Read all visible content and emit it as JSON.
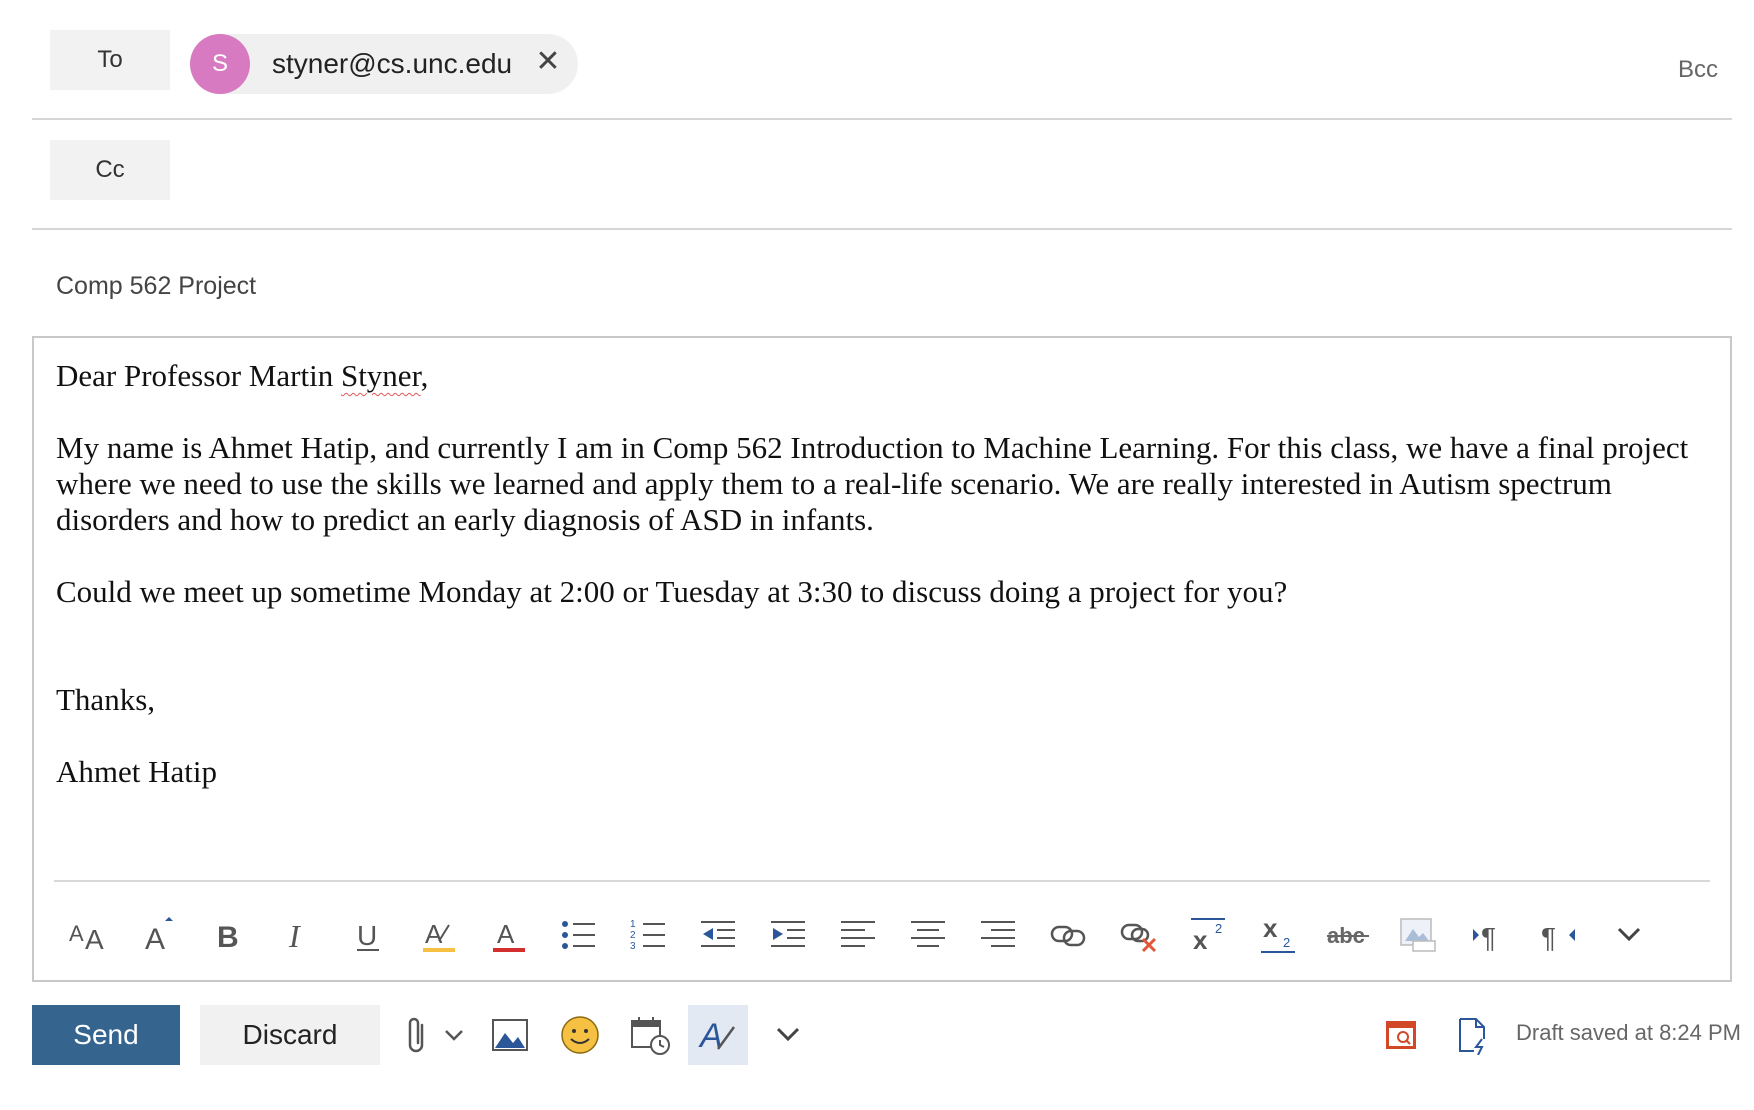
{
  "recipients": {
    "to_label": "To",
    "cc_label": "Cc",
    "bcc_label": "Bcc",
    "to_chips": [
      {
        "initial": "S",
        "email": "styner@cs.unc.edu",
        "avatar_color": "#d87ac1"
      }
    ]
  },
  "subject": {
    "value": "Comp 562 Project"
  },
  "body": {
    "greeting_prefix": "Dear Professor Martin ",
    "greeting_misspelled": "Styner",
    "greeting_suffix": ",",
    "paragraph1": "My name is Ahmet Hatip, and currently I am in Comp 562 Introduction to Machine Learning. For this class, we have a final project where we need to use the skills we learned and apply them to a real-life scenario. We are really interested in Autism spectrum disorders and how to predict an early diagnosis of ASD in infants.",
    "paragraph2": "Could we meet up sometime Monday at 2:00 or Tuesday at 3:30 to discuss doing a project for you?",
    "closing": "Thanks,",
    "signature": "Ahmet Hatip"
  },
  "format_toolbar": {
    "icons": [
      "font-size-icon",
      "grow-font-icon",
      "bold-icon",
      "italic-icon",
      "underline-icon",
      "highlight-icon",
      "font-color-icon",
      "bullets-icon",
      "numbering-icon",
      "decrease-indent-icon",
      "increase-indent-icon",
      "align-left-icon",
      "align-center-icon",
      "align-right-icon",
      "insert-link-icon",
      "remove-link-icon",
      "superscript-icon",
      "subscript-icon",
      "strikethrough-icon",
      "insert-picture-inline-icon",
      "ltr-icon",
      "rtl-icon",
      "more-formatting-icon"
    ]
  },
  "actions": {
    "send_label": "Send",
    "discard_label": "Discard",
    "draft_status": "Draft saved at 8:24 PM",
    "accent_color": "#35648f"
  }
}
